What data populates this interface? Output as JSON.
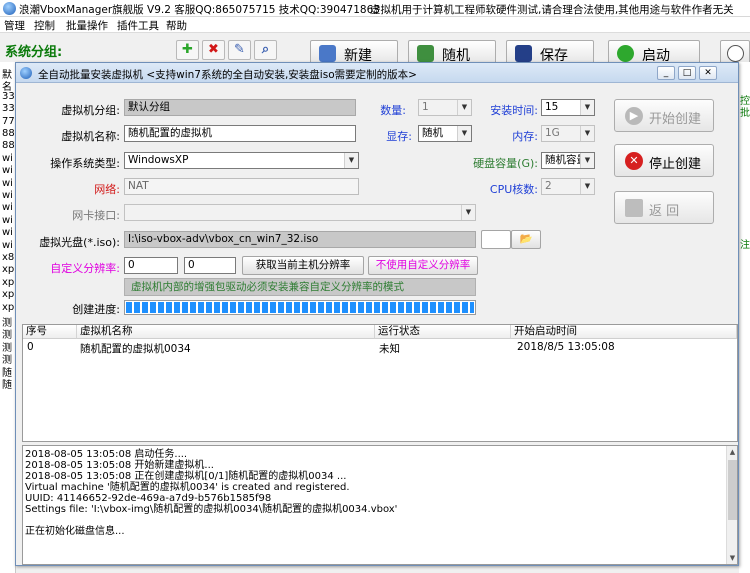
{
  "app": {
    "title": "浪潮VboxManager旗舰版 V9.2   客服QQ:865075715 技术QQ:390471863",
    "subtitle": "虚拟机用于计算机工程师软硬件测试,请合理合法使用,其他用途与软件作者无关",
    "menu": [
      "管理",
      "控制",
      "批量操作",
      "插件工具",
      "帮助"
    ],
    "group_label": "系统分组:",
    "toolbar": {
      "add": "✚",
      "delete": "✖",
      "edit": "✎",
      "search": "⌕"
    },
    "big_buttons": [
      "新建",
      "随机",
      "保存",
      "启动"
    ],
    "left_strip": [
      "默",
      "名",
      "33",
      "33",
      "77",
      "88",
      "88",
      "wi",
      "wi",
      "wi",
      "wi",
      "wi",
      "wi",
      "wi",
      "wi",
      "x8",
      "xp",
      "xp",
      "xp",
      "xp",
      "测",
      "测",
      "测",
      "测",
      "随",
      "随"
    ],
    "right_strip": [
      "控",
      "批",
      "",
      "",
      "",
      "",
      "",
      "",
      "",
      "",
      "",
      "",
      "注",
      "",
      "",
      "",
      "",
      "",
      "",
      "",
      "",
      "",
      "",
      "",
      "",
      "",
      "",
      "",
      "",
      "",
      "",
      "",
      "",
      "",
      "",
      "",
      "",
      ""
    ]
  },
  "dialog": {
    "title": "全自动批量安装虚拟机 <支持win7系统的全自动安装,安装盘iso需要定制的版本>",
    "window_buttons": [
      "_",
      "□",
      "✕"
    ],
    "labels": {
      "vm_group": "虚拟机分组:",
      "vm_name": "虚拟机名称:",
      "os_type": "操作系统类型:",
      "network": "网络:",
      "nic": "网卡接口:",
      "iso": "虚拟光盘(*.iso):",
      "custom_res": "自定义分辨率:",
      "progress": "创建进度:",
      "count": "数量:",
      "install_time": "安装时间:",
      "vram": "显存:",
      "memory": "内存:",
      "disk": "硬盘容量(G):",
      "cpu": "CPU核数:"
    },
    "values": {
      "vm_group": "默认分组",
      "vm_name": "随机配置的虚拟机",
      "os_type": "WindowsXP",
      "network": "NAT",
      "nic": "",
      "iso": "I:\\iso-vbox-adv\\vbox_cn_win7_32.iso",
      "res_w": "0",
      "res_h": "0",
      "count": "1",
      "install_time": "15",
      "vram": "随机",
      "memory": "1G",
      "disk": "随机容量",
      "cpu": "2"
    },
    "buttons": {
      "get_res": "获取当前主机分辨率",
      "no_custom_res": "不使用自定义分辨率",
      "start_create": "开始创建",
      "stop_create": "停止创建",
      "back": "返     回",
      "browse": "📂"
    },
    "hint": "虚拟机内部的增强包驱动必须安装兼容自定义分辨率的模式",
    "progress": 1.0,
    "table": {
      "headers": [
        "序号",
        "虚拟机名称",
        "运行状态",
        "开始启动时间"
      ],
      "rows": [
        [
          "0",
          "随机配置的虚拟机0034",
          "未知",
          "2018/8/5 13:05:08"
        ]
      ]
    },
    "log": [
      "2018-08-05 13:05:08 启动任务....",
      "2018-08-05 13:05:08 开始新建虚拟机...",
      "2018-08-05 13:05:08 正在创建虚拟机[0/1]随机配置的虚拟机0034 ...",
      "Virtual machine '随机配置的虚拟机0034' is created and registered.",
      "UUID: 41146652-92de-469a-a7d9-b576b1585f98",
      "Settings file: 'I:\\vbox-img\\随机配置的虚拟机0034\\随机配置的虚拟机0034.vbox'",
      "",
      " 正在初始化磁盘信息..."
    ]
  },
  "colors": {
    "accent": "#1e90ff",
    "label_blue": "#1f3fd6",
    "label_red": "#d21818",
    "label_green": "#2e7d32",
    "label_magenta": "#e000e0"
  }
}
